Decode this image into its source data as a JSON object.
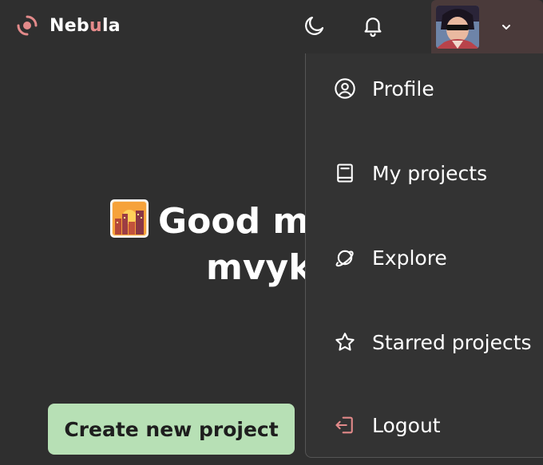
{
  "header": {
    "brand": {
      "prefix": "Neb",
      "accent": "u",
      "suffix": "la"
    },
    "colors": {
      "background": "#2f2f2f",
      "accent": "#e38a8a",
      "cta": "#b7e0b5"
    },
    "icons": {
      "logo": "nebula-logo-icon",
      "theme": "moon-icon",
      "notifications": "bell-icon",
      "chevron": "chevron-down-icon"
    }
  },
  "hero": {
    "greeting_line1": "Good m",
    "greeting_line2": "mvyk",
    "emoji": "sunset-city-emoji"
  },
  "actions": {
    "create_project": "Create new project"
  },
  "menu": {
    "items": [
      {
        "label": "Profile",
        "icon": "user-circle-icon"
      },
      {
        "label": "My projects",
        "icon": "book-icon"
      },
      {
        "label": "Explore",
        "icon": "planet-icon"
      },
      {
        "label": "Starred projects",
        "icon": "star-icon"
      },
      {
        "label": "Logout",
        "icon": "logout-icon"
      }
    ]
  }
}
